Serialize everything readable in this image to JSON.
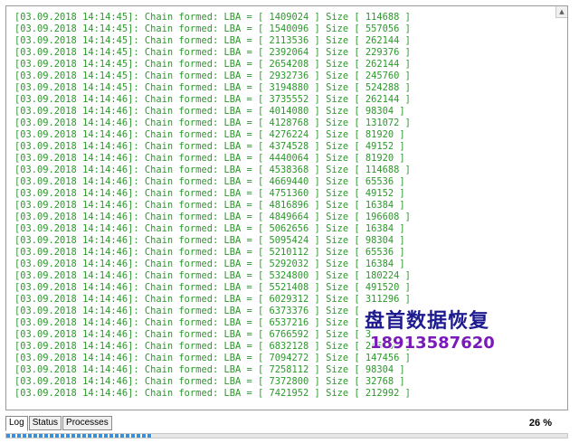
{
  "log": {
    "lines": [
      "[03.09.2018 14:14:45]: Chain formed: LBA = [ 1409024 ] Size [ 114688 ]",
      "[03.09.2018 14:14:45]: Chain formed: LBA = [ 1540096 ] Size [ 557056 ]",
      "[03.09.2018 14:14:45]: Chain formed: LBA = [ 2113536 ] Size [ 262144 ]",
      "[03.09.2018 14:14:45]: Chain formed: LBA = [ 2392064 ] Size [ 229376 ]",
      "[03.09.2018 14:14:45]: Chain formed: LBA = [ 2654208 ] Size [ 262144 ]",
      "[03.09.2018 14:14:45]: Chain formed: LBA = [ 2932736 ] Size [ 245760 ]",
      "[03.09.2018 14:14:45]: Chain formed: LBA = [ 3194880 ] Size [ 524288 ]",
      "[03.09.2018 14:14:46]: Chain formed: LBA = [ 3735552 ] Size [ 262144 ]",
      "[03.09.2018 14:14:46]: Chain formed: LBA = [ 4014080 ] Size [ 98304 ]",
      "[03.09.2018 14:14:46]: Chain formed: LBA = [ 4128768 ] Size [ 131072 ]",
      "[03.09.2018 14:14:46]: Chain formed: LBA = [ 4276224 ] Size [ 81920 ]",
      "[03.09.2018 14:14:46]: Chain formed: LBA = [ 4374528 ] Size [ 49152 ]",
      "[03.09.2018 14:14:46]: Chain formed: LBA = [ 4440064 ] Size [ 81920 ]",
      "[03.09.2018 14:14:46]: Chain formed: LBA = [ 4538368 ] Size [ 114688 ]",
      "[03.09.2018 14:14:46]: Chain formed: LBA = [ 4669440 ] Size [ 65536 ]",
      "[03.09.2018 14:14:46]: Chain formed: LBA = [ 4751360 ] Size [ 49152 ]",
      "[03.09.2018 14:14:46]: Chain formed: LBA = [ 4816896 ] Size [ 16384 ]",
      "[03.09.2018 14:14:46]: Chain formed: LBA = [ 4849664 ] Size [ 196608 ]",
      "[03.09.2018 14:14:46]: Chain formed: LBA = [ 5062656 ] Size [ 16384 ]",
      "[03.09.2018 14:14:46]: Chain formed: LBA = [ 5095424 ] Size [ 98304 ]",
      "[03.09.2018 14:14:46]: Chain formed: LBA = [ 5210112 ] Size [ 65536 ]",
      "[03.09.2018 14:14:46]: Chain formed: LBA = [ 5292032 ] Size [ 16384 ]",
      "[03.09.2018 14:14:46]: Chain formed: LBA = [ 5324800 ] Size [ 180224 ]",
      "[03.09.2018 14:14:46]: Chain formed: LBA = [ 5521408 ] Size [ 491520 ]",
      "[03.09.2018 14:14:46]: Chain formed: LBA = [ 6029312 ] Size [ 311296 ]",
      "[03.09.2018 14:14:46]: Chain formed: LBA = [ 6373376 ] Size [",
      "[03.09.2018 14:14:46]: Chain formed: LBA = [ 6537216 ] Size [",
      "[03.09.2018 14:14:46]: Chain formed: LBA = [ 6766592 ] Size [ 3",
      "[03.09.2018 14:14:46]: Chain formed: LBA = [ 6832128 ] Size [ 245760 ]",
      "[03.09.2018 14:14:46]: Chain formed: LBA = [ 7094272 ] Size [ 147456 ]",
      "[03.09.2018 14:14:46]: Chain formed: LBA = [ 7258112 ] Size [ 98304 ]",
      "[03.09.2018 14:14:46]: Chain formed: LBA = [ 7372800 ] Size [ 32768 ]",
      "[03.09.2018 14:14:46]: Chain formed: LBA = [ 7421952 ] Size [ 212992 ]"
    ],
    "scroll_arrow_icon": "triangle-up-icon"
  },
  "watermark": {
    "title": "盘首数据恢复",
    "phone": "18913587620"
  },
  "tabs": [
    {
      "label": "Log",
      "active": true
    },
    {
      "label": "Status",
      "active": false
    },
    {
      "label": "Processes",
      "active": false
    }
  ],
  "progress": {
    "percent_label": "26 %",
    "fraction": 0.26
  },
  "colors": {
    "log_text": "#2a9a2a",
    "watermark_title": "#1d1b8f",
    "watermark_phone": "#7a1ab8",
    "progress_fill": "#3b8fd9"
  }
}
